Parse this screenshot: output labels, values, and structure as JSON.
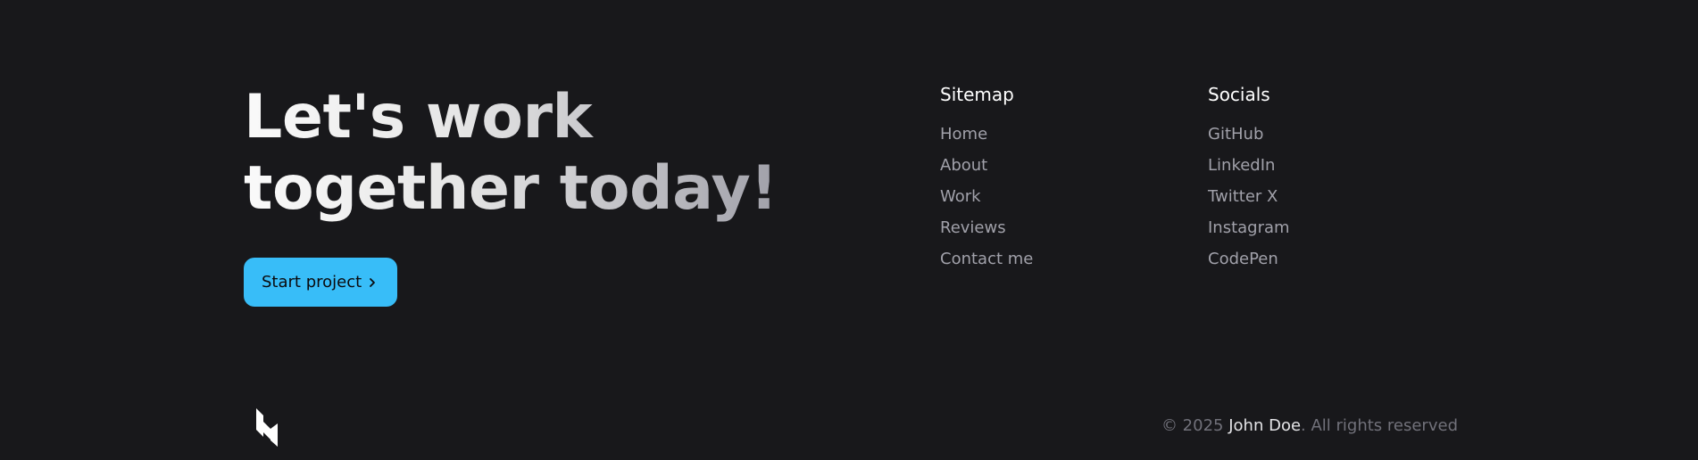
{
  "hero": {
    "headline_line1": "Let's work",
    "headline_line2": "together today!",
    "cta_label": "Start project",
    "cta_icon": "chevron-right-icon",
    "cta_color": "#38bdf8"
  },
  "sitemap": {
    "title": "Sitemap",
    "items": [
      "Home",
      "About",
      "Work",
      "Reviews",
      "Contact me"
    ]
  },
  "socials": {
    "title": "Socials",
    "items": [
      "GitHub",
      "LinkedIn",
      "Twitter X",
      "Instagram",
      "CodePen"
    ]
  },
  "bottom": {
    "logo_icon": "brand-logo-icon",
    "copyright_prefix": "© 2025 ",
    "copyright_name": "John Doe",
    "copyright_suffix": ". All rights reserved"
  },
  "colors": {
    "background": "#18181b",
    "muted_text": "#a1a1aa",
    "accent": "#38bdf8"
  }
}
